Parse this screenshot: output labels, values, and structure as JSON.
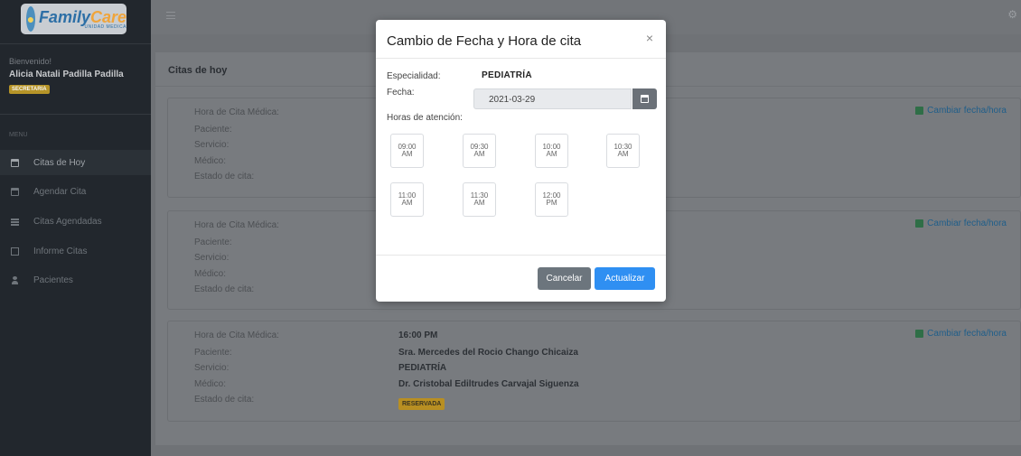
{
  "sidebar": {
    "logo": {
      "name_a": "Family",
      "name_b": "Care",
      "subtitle": "UNIDAD MEDICA"
    },
    "welcome": "Bienvenido!",
    "user_name": "Alicia Natali Padilla Padilla",
    "role": "SECRETARIA",
    "menu_label": "MENU",
    "items": [
      {
        "label": "Citas de Hoy",
        "icon": "calendar-icon"
      },
      {
        "label": "Agendar Cita",
        "icon": "calendar-plus-icon"
      },
      {
        "label": "Citas Agendadas",
        "icon": "table-icon"
      },
      {
        "label": "Informe Citas",
        "icon": "file-icon"
      },
      {
        "label": "Pacientes",
        "icon": "user-icon"
      }
    ]
  },
  "topbar": {
    "menu_icon": "hamburger-icon",
    "settings_icon": "gear-icon"
  },
  "main": {
    "header": "Citas de hoy",
    "labels": {
      "hora": "Hora de Cita Médica:",
      "paciente": "Paciente:",
      "servicio": "Servicio:",
      "medico": "Médico:",
      "estado": "Estado de cita:"
    },
    "change_link": "Cambiar fecha/hora",
    "appointments": [
      {
        "hora": "",
        "paciente": "",
        "servicio": "",
        "medico": "",
        "estado": ""
      },
      {
        "hora": "",
        "paciente": "",
        "servicio": "",
        "medico": "",
        "estado": ""
      },
      {
        "hora": "16:00 PM",
        "paciente": "Sra. Mercedes del Rocio Chango Chicaiza",
        "servicio": "PEDIATRÍA",
        "medico": "Dr. Cristobal Ediltrudes Carvajal Siguenza",
        "estado": "RESERVADA"
      }
    ]
  },
  "modal": {
    "title": "Cambio de Fecha y Hora de cita",
    "close": "×",
    "especialidad_label": "Especialidad:",
    "especialidad_value": "PEDIATRÍA",
    "fecha_label": "Fecha:",
    "fecha_value": "2021-03-29",
    "horas_label": "Horas de atención:",
    "slots": [
      {
        "time": "09:00",
        "period": "AM"
      },
      {
        "time": "09:30",
        "period": "AM"
      },
      {
        "time": "10:00",
        "period": "AM"
      },
      {
        "time": "10:30",
        "period": "AM"
      },
      {
        "time": "11:00",
        "period": "AM"
      },
      {
        "time": "11:30",
        "period": "AM"
      },
      {
        "time": "12:00",
        "period": "PM"
      }
    ],
    "cancel_label": "Cancelar",
    "update_label": "Actualizar"
  },
  "colors": {
    "primary": "#2f8ff2",
    "secondary": "#6c757d",
    "warning": "#b88f22",
    "sidebar": "#22272d"
  }
}
